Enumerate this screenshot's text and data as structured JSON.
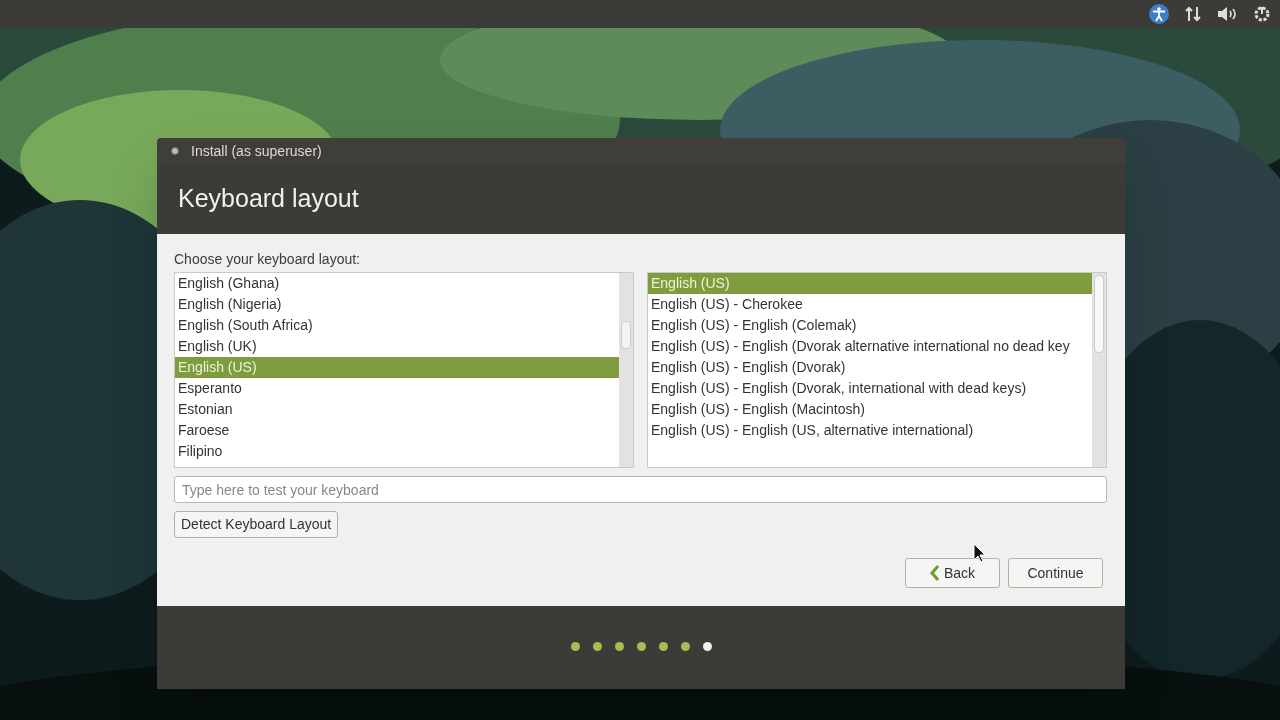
{
  "window": {
    "title": "Install (as superuser)"
  },
  "heading": "Keyboard layout",
  "prompt": "Choose your keyboard layout:",
  "layouts": [
    {
      "label": "English (Ghana)",
      "selected": false
    },
    {
      "label": "English (Nigeria)",
      "selected": false
    },
    {
      "label": "English (South Africa)",
      "selected": false
    },
    {
      "label": "English (UK)",
      "selected": false
    },
    {
      "label": "English (US)",
      "selected": true
    },
    {
      "label": "Esperanto",
      "selected": false
    },
    {
      "label": "Estonian",
      "selected": false
    },
    {
      "label": "Faroese",
      "selected": false
    },
    {
      "label": "Filipino",
      "selected": false
    }
  ],
  "variants": [
    {
      "label": "English (US)",
      "selected": true
    },
    {
      "label": "English (US) - Cherokee",
      "selected": false
    },
    {
      "label": "English (US) - English (Colemak)",
      "selected": false
    },
    {
      "label": "English (US) - English (Dvorak alternative international no dead key",
      "selected": false
    },
    {
      "label": "English (US) - English (Dvorak)",
      "selected": false
    },
    {
      "label": "English (US) - English (Dvorak, international with dead keys)",
      "selected": false
    },
    {
      "label": "English (US) - English (Macintosh)",
      "selected": false
    },
    {
      "label": "English (US) - English (US, alternative international)",
      "selected": false
    }
  ],
  "test_field": {
    "placeholder": "Type here to test your keyboard"
  },
  "detect_button": "Detect Keyboard Layout",
  "buttons": [
    {
      "label": "Back",
      "kind": "back"
    },
    {
      "label": "Continue",
      "kind": "plain"
    }
  ],
  "steps": [
    {
      "selected": false
    },
    {
      "selected": false
    },
    {
      "selected": false
    },
    {
      "selected": false
    },
    {
      "selected": false
    },
    {
      "selected": false
    },
    {
      "selected": true
    }
  ]
}
